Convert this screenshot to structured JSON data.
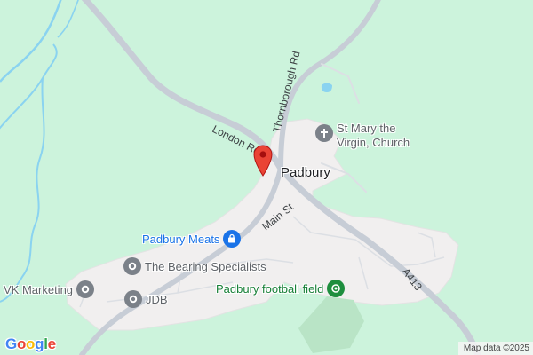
{
  "map": {
    "place_label": "Padbury",
    "roads": [
      "London Rd",
      "Thornborough Rd",
      "Main St",
      "A413"
    ],
    "pois": [
      {
        "label": "St Mary the Virgin, Church",
        "line1": "St Mary the",
        "line2": "Virgin, Church",
        "icon": "church-icon"
      },
      {
        "label": "Padbury Meats",
        "icon": "shopping-bag-icon"
      },
      {
        "label": "The Bearing Specialists",
        "icon": "place-icon"
      },
      {
        "label": "VK Marketing",
        "icon": "place-icon"
      },
      {
        "label": "JDB",
        "icon": "place-icon"
      },
      {
        "label": "Padbury football field",
        "icon": "park-icon"
      }
    ],
    "marker_icon": "red-location-pin-icon",
    "logo": "Google",
    "attribution": "Map data ©2025",
    "colors": {
      "land": "#ccf3dc",
      "urban": "#f1efef",
      "road": "#c7cdd6",
      "water": "#8ad3f0",
      "sports_field": "#b9e4c6",
      "marker": "#ea4335",
      "shop_blue": "#1a73e8",
      "park_green": "#188038",
      "poi_grey": "#7b8189"
    }
  }
}
